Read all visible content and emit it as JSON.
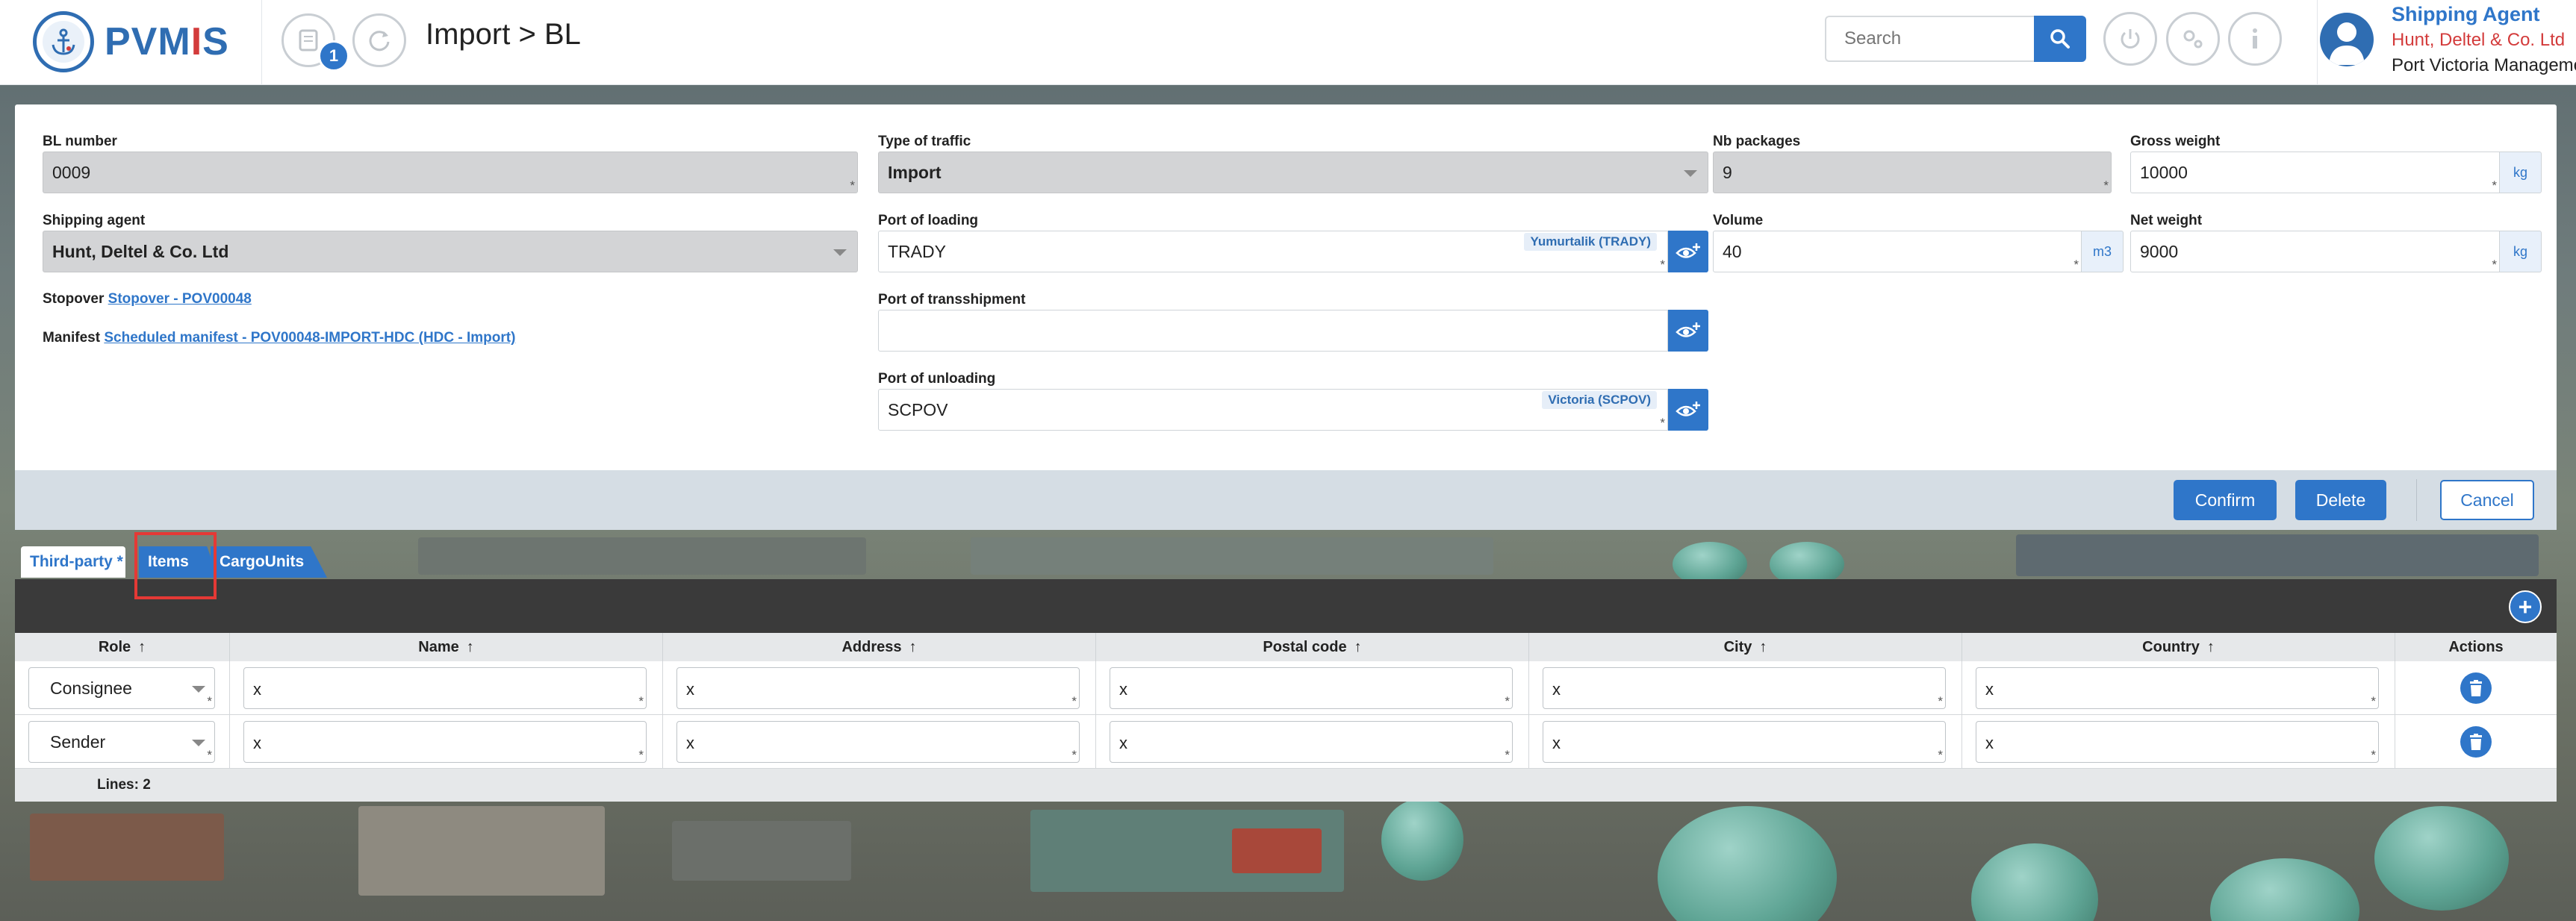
{
  "app": {
    "logo_text_a": "PVM",
    "logo_text_i": "I",
    "logo_text_b": "S",
    "notification_count": "1",
    "breadcrumb": "Import > BL"
  },
  "search": {
    "placeholder": "Search"
  },
  "user": {
    "role": "Shipping Agent",
    "agent": "Hunt, Deltel & Co. Ltd",
    "organization": "Port Victoria Management"
  },
  "form": {
    "bl_number": {
      "label": "BL number",
      "value": "0009"
    },
    "type_of_traffic": {
      "label": "Type of traffic",
      "value": "Import"
    },
    "nb_packages": {
      "label": "Nb packages",
      "value": "9"
    },
    "gross_weight": {
      "label": "Gross weight",
      "value": "10000",
      "unit": "kg"
    },
    "shipping_agent": {
      "label": "Shipping agent",
      "value": "Hunt, Deltel & Co. Ltd"
    },
    "port_of_loading": {
      "label": "Port of loading",
      "value": "TRADY",
      "hint": "Yumurtalik (TRADY)"
    },
    "volume": {
      "label": "Volume",
      "value": "40",
      "unit": "m3"
    },
    "net_weight": {
      "label": "Net weight",
      "value": "9000",
      "unit": "kg"
    },
    "stopover": {
      "label": "Stopover",
      "link": "Stopover - POV00048"
    },
    "manifest": {
      "label": "Manifest",
      "link": "Scheduled manifest - POV00048-IMPORT-HDC (HDC - Import)"
    },
    "port_of_transshipment": {
      "label": "Port of transshipment",
      "value": ""
    },
    "port_of_unloading": {
      "label": "Port of unloading",
      "value": "SCPOV",
      "hint": "Victoria (SCPOV)"
    },
    "required_mark": "*"
  },
  "actions": {
    "confirm": "Confirm",
    "delete": "Delete",
    "cancel": "Cancel"
  },
  "tabs": [
    {
      "label": "Third-party *",
      "active": true
    },
    {
      "label": "Items",
      "active": false
    },
    {
      "label": "CargoUnits",
      "active": false
    }
  ],
  "table": {
    "add_label": "+",
    "columns": [
      "Role",
      "Name",
      "Address",
      "Postal code",
      "City",
      "Country",
      "Actions"
    ],
    "sort_arrow": "↑",
    "rows": [
      {
        "role": "Consignee",
        "name": "x",
        "address": "x",
        "postal_code": "x",
        "city": "x",
        "country": "x"
      },
      {
        "role": "Sender",
        "name": "x",
        "address": "x",
        "postal_code": "x",
        "city": "x",
        "country": "x"
      }
    ],
    "lines_label": "Lines: 2"
  },
  "colors": {
    "accent": "#2f76c9",
    "brand": "#2f6db2",
    "agent_red": "#d33b3b",
    "highlight": "#e53935"
  }
}
